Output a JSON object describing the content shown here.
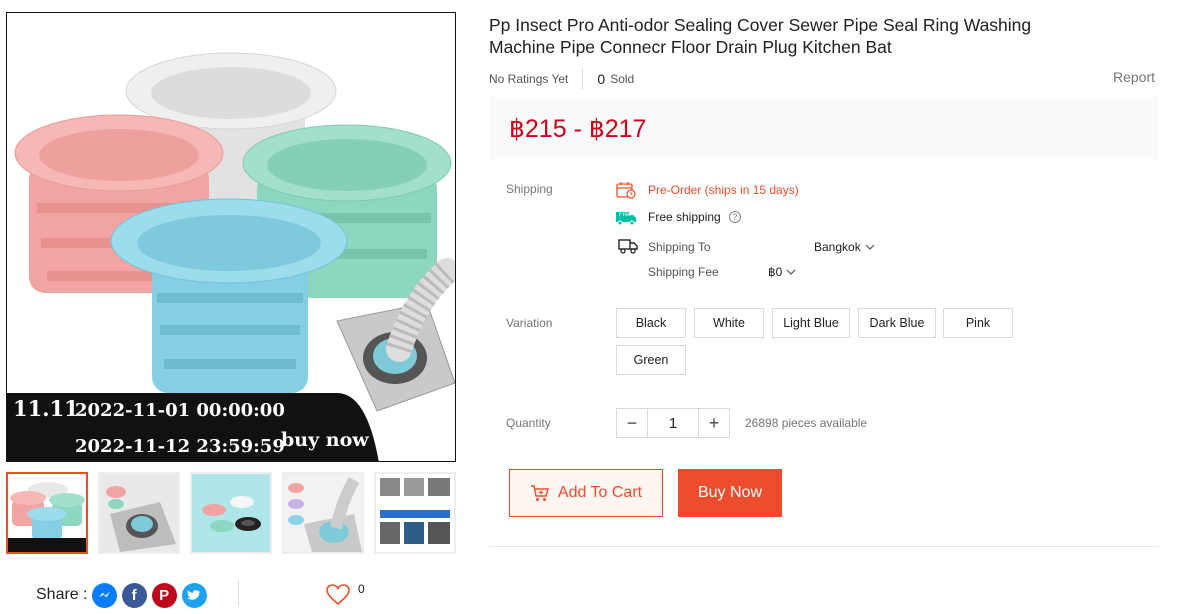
{
  "gallery": {
    "promo": {
      "tag": "11.11",
      "start": "2022-11-01 00:00:00",
      "end": "2022-11-12 23:59:59",
      "cta": "buy now"
    },
    "thumbnails": [
      {
        "name": "thumbnail-1",
        "active": true
      },
      {
        "name": "thumbnail-2",
        "active": false
      },
      {
        "name": "thumbnail-3",
        "active": false
      },
      {
        "name": "thumbnail-4",
        "active": false
      },
      {
        "name": "thumbnail-5",
        "active": false
      }
    ],
    "colors": {
      "pink": "#f4a6a6",
      "white": "#e8e8e8",
      "green": "#8fd8c0",
      "blue": "#8fd4e6",
      "band": "#111111"
    }
  },
  "share": {
    "label": "Share :",
    "networks": [
      "messenger-icon",
      "facebook-icon",
      "pinterest-icon",
      "twitter-icon"
    ],
    "favorite_count": "0"
  },
  "product": {
    "title": "Pp Insect Pro Anti-odor Sealing Cover Sewer Pipe Seal Ring Washing Machine Pipe Connecr Floor Drain Plug Kitchen Bat",
    "ratings": "No Ratings Yet",
    "sold_count": "0",
    "sold_label": "Sold",
    "report": "Report",
    "price": "฿215 - ฿217",
    "accent": "#ee4d2d"
  },
  "shipping": {
    "label": "Shipping",
    "preorder": "Pre-Order (ships in 15 days)",
    "free_badge": "Free",
    "free_shipping": "Free shipping",
    "ship_to_label": "Shipping To",
    "ship_to_value": "Bangkok",
    "fee_label": "Shipping Fee",
    "fee_value": "฿0"
  },
  "variation": {
    "label": "Variation",
    "options": [
      "Black",
      "White",
      "Light Blue",
      "Dark Blue",
      "Pink",
      "Green"
    ]
  },
  "quantity": {
    "label": "Quantity",
    "minus": "−",
    "value": "1",
    "plus": "+",
    "available": "26898 pieces available"
  },
  "actions": {
    "add_to_cart": "Add To Cart",
    "buy_now": "Buy Now"
  }
}
